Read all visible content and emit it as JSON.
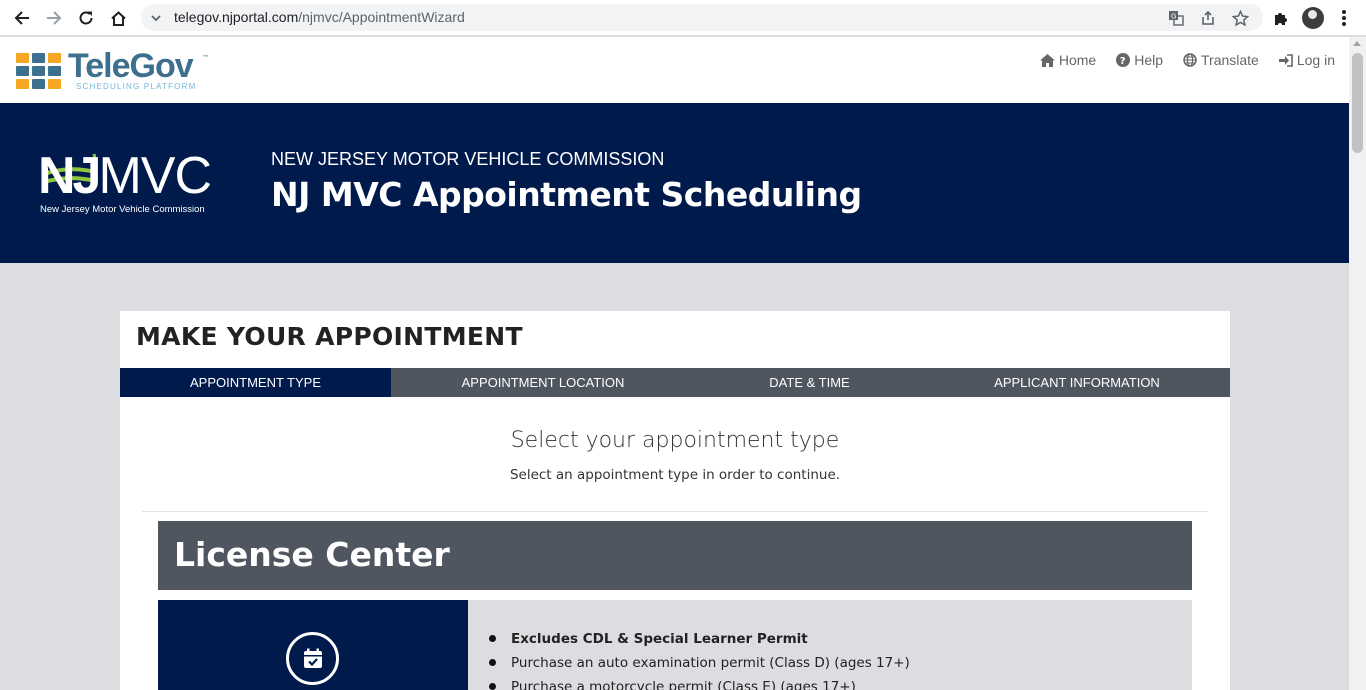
{
  "browser": {
    "url_host": "telegov.njportal.com",
    "url_path": "/njmvc/AppointmentWizard",
    "icons": [
      "back-icon",
      "forward-icon",
      "reload-icon",
      "home-icon",
      "translate-icon",
      "share-icon",
      "star-icon",
      "extensions-icon",
      "profile-avatar",
      "menu-icon"
    ]
  },
  "site": {
    "logo_tele": "Tele",
    "logo_gov": "Gov",
    "logo_tm": "™",
    "logo_subtitle": "SCHEDULING PLATFORM",
    "nav": [
      {
        "label": "Home",
        "icon": "home-icon"
      },
      {
        "label": "Help",
        "icon": "help-icon"
      },
      {
        "label": "Translate",
        "icon": "globe-icon"
      },
      {
        "label": "Log in",
        "icon": "login-icon"
      }
    ]
  },
  "banner": {
    "logo_nj": "NJ",
    "logo_mvc": "MVC",
    "logo_caption": "New Jersey Motor Vehicle Commission",
    "subtitle": "NEW JERSEY MOTOR VEHICLE COMMISSION",
    "title": "NJ MVC Appointment Scheduling"
  },
  "card": {
    "title": "MAKE YOUR APPOINTMENT",
    "steps": [
      {
        "label": "APPOINTMENT TYPE",
        "active": true
      },
      {
        "label": "APPOINTMENT LOCATION",
        "active": false
      },
      {
        "label": "DATE & TIME",
        "active": false
      },
      {
        "label": "APPLICANT INFORMATION",
        "active": false
      }
    ],
    "select_title": "Select your appointment type",
    "select_subtitle": "Select an appointment type in order to continue.",
    "section_title": "License Center",
    "appointment": {
      "icon": "calendar-check-icon",
      "items": [
        "Excludes CDL & Special Learner Permit",
        "Purchase an auto examination permit (Class D) (ages 17+)",
        "Purchase a motorcycle permit (Class E) (ages 17+)"
      ]
    }
  },
  "colors": {
    "navy": "#001a4c",
    "slate": "#4f5660",
    "page_bg": "#dcdde0"
  }
}
